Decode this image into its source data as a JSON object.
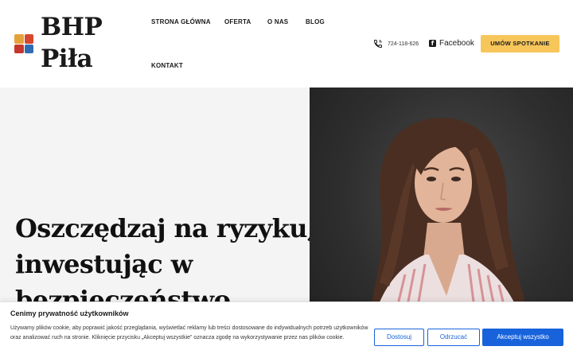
{
  "brand": {
    "line1": "BHP",
    "line2": "Piła",
    "crest_colors": [
      "#e5a23a",
      "#d9462f",
      "#c5362c",
      "#2f6bb3"
    ]
  },
  "nav": {
    "items": [
      {
        "label": "STRONA GŁÓWNA"
      },
      {
        "label": "OFERTA"
      },
      {
        "label": "O NAS"
      },
      {
        "label": "BLOG"
      },
      {
        "label": "KONTAKT"
      }
    ]
  },
  "contact": {
    "phone": "724-118-626",
    "facebook": "Facebook",
    "cta": "UMÓW SPOTKANIE",
    "cta_color": "#f7c65b"
  },
  "hero": {
    "title_lines": [
      "Oszczędzaj na ryzyku,",
      "inwestując w",
      "bezpieczeństwo"
    ],
    "image": "portrait-photo"
  },
  "cookie": {
    "title": "Cenimy prywatność użytkowników",
    "text": "Używamy plików cookie, aby poprawić jakość przeglądania, wyświetlać reklamy lub treści dostosowane do indywidualnych potrzeb użytkowników oraz analizować ruch na stronie. Kliknięcie przycisku „Akceptuj wszystkie” oznacza zgodę na wykorzystywanie przez nas plików cookie.",
    "btn_customize": "Dostosuj",
    "btn_reject": "Odrzucać",
    "btn_accept": "Akceptuj wszystko",
    "accent_color": "#1863dc"
  }
}
